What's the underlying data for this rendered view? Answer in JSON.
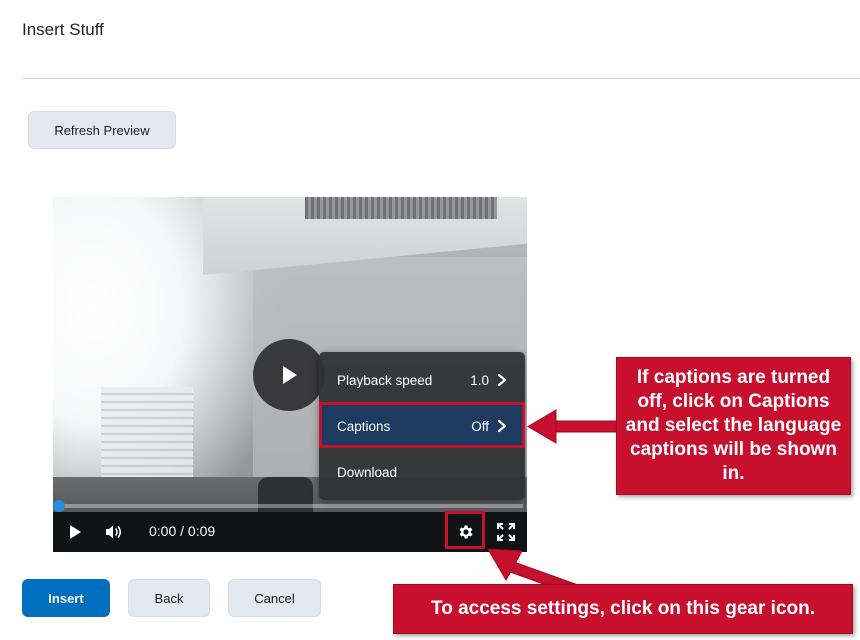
{
  "header": {
    "title": "Insert Stuff"
  },
  "toolbar": {
    "refresh_label": "Refresh Preview"
  },
  "video": {
    "settings_menu": {
      "items": [
        {
          "label": "Playback speed",
          "value": "1.0",
          "has_submenu": true,
          "icon": "chevron-right-icon"
        },
        {
          "label": "Captions",
          "value": "Off",
          "has_submenu": true,
          "icon": "chevron-right-icon",
          "selected": true
        },
        {
          "label": "Download",
          "value": "",
          "has_submenu": false
        }
      ]
    },
    "time_display": "0:00 / 0:09",
    "progress": 0,
    "controls": [
      "play-icon",
      "volume-icon",
      "gear-icon",
      "fullscreen-icon"
    ]
  },
  "annotations": {
    "captions_callout": "If captions are turned off, click on Captions and select the language captions will be shown in.",
    "gear_callout": "To access settings, click on this gear icon.",
    "highlight_color": "#c8102e"
  },
  "footer": {
    "insert_label": "Insert",
    "back_label": "Back",
    "cancel_label": "Cancel"
  },
  "colors": {
    "primary": "#006fbf",
    "secondary_button": "#e3e9f1",
    "menu_selected": "#1d3b60",
    "annotation_red": "#c8102e"
  }
}
